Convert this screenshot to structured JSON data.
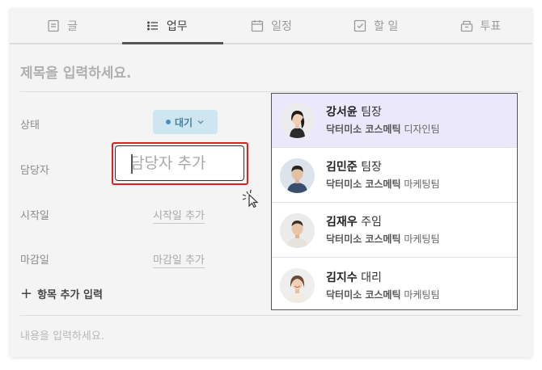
{
  "tabs": [
    {
      "label": "글",
      "icon": "document-icon",
      "active": false
    },
    {
      "label": "업무",
      "icon": "task-list-icon",
      "active": true
    },
    {
      "label": "일정",
      "icon": "calendar-icon",
      "active": false
    },
    {
      "label": "할 일",
      "icon": "checkbox-icon",
      "active": false
    },
    {
      "label": "투표",
      "icon": "ballot-box-icon",
      "active": false
    }
  ],
  "form": {
    "title_placeholder": "제목을 입력하세요.",
    "status_label": "상태",
    "status_value": "대기",
    "status_color": "#cde6f0",
    "assignee_label": "담당자",
    "assignee_placeholder": "담당자 추가",
    "start_label": "시작일",
    "start_placeholder": "시작일 추가",
    "due_label": "마감일",
    "due_placeholder": "마감일 추가",
    "add_item_label": "항목 추가 입력",
    "content_placeholder": "내용을 입력하세요."
  },
  "dropdown": {
    "members": [
      {
        "name": "강서윤",
        "title": "팀장",
        "org": "닥터미소 코스메틱",
        "team": "디자인팀",
        "highlighted": true
      },
      {
        "name": "김민준",
        "title": "팀장",
        "org": "닥터미소 코스메틱",
        "team": "마케팅팀",
        "highlighted": false
      },
      {
        "name": "김재우",
        "title": "주임",
        "org": "닥터미소 코스메틱",
        "team": "마케팅팀",
        "highlighted": false
      },
      {
        "name": "김지수",
        "title": "대리",
        "org": "닥터미소 코스메틱",
        "team": "마케팅팀",
        "highlighted": false
      }
    ]
  },
  "colors": {
    "highlight": "#ece8fb",
    "focus_border": "#e02020",
    "status_text": "#4a7fa0"
  }
}
